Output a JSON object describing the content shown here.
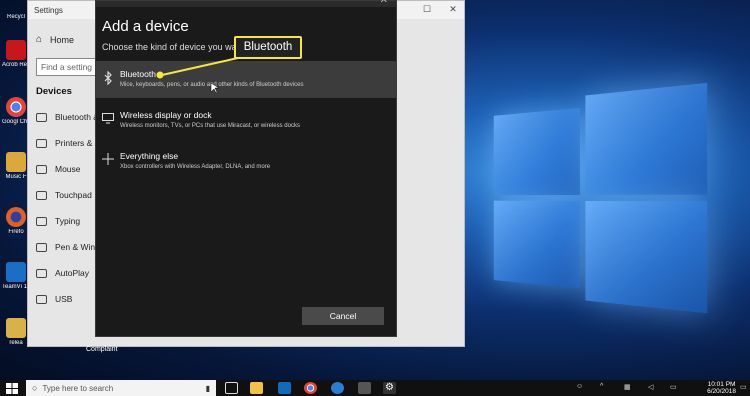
{
  "settings": {
    "title": "Settings",
    "home_label": "Home",
    "search_placeholder": "Find a setting",
    "section_title": "Devices",
    "nav_items": [
      "Bluetooth &",
      "Printers & sc",
      "Mouse",
      "Touchpad",
      "Typing",
      "Pen & Wind",
      "AutoPlay",
      "USB"
    ],
    "under_text": "Complaint"
  },
  "dialog": {
    "title": "Add a device",
    "subtitle": "Choose the kind of device you want",
    "options": [
      {
        "icon": "bluetooth-icon",
        "title": "Bluetooth",
        "desc": "Mice, keyboards, pens, or audio and other kinds of Bluetooth devices"
      },
      {
        "icon": "monitor-icon",
        "title": "Wireless display or dock",
        "desc": "Wireless monitors, TVs, or PCs that use Miracast, or wireless docks"
      },
      {
        "icon": "plus-icon",
        "title": "Everything else",
        "desc": "Xbox controllers with Wireless Adapter, DLNA, and more"
      }
    ],
    "cancel_label": "Cancel"
  },
  "callout": {
    "label": "Bluetooth",
    "color": "#f5e83b"
  },
  "desktop_icons": [
    {
      "label": "Recycl",
      "color": "#9aa7b3"
    },
    {
      "label": "Acrob Reader",
      "color": "#c8161d"
    },
    {
      "label": "Googl Chrom",
      "color": "#3b8ef0"
    },
    {
      "label": "Music F",
      "color": "#d9a93b"
    },
    {
      "label": "Firefo",
      "color": "#e0601d"
    },
    {
      "label": "TeamVi 13",
      "color": "#1a6fc4"
    },
    {
      "label": "relea",
      "color": "#d9b04a"
    }
  ],
  "taskbar": {
    "search_placeholder": "Type here to search",
    "time": "10:01 PM",
    "date": "6/20/2018"
  }
}
